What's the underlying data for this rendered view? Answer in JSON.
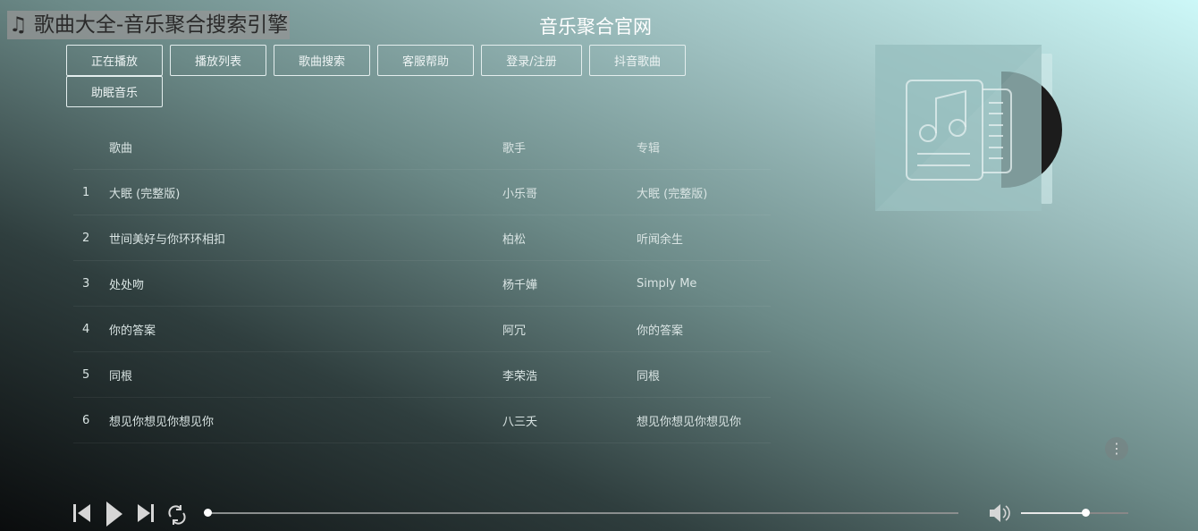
{
  "header": {
    "site_title": "♫ 歌曲大全-音乐聚合搜索引擎",
    "brand": "音乐聚合官网"
  },
  "nav": [
    "正在播放",
    "播放列表",
    "歌曲搜索",
    "客服帮助",
    "登录/注册",
    "抖音歌曲",
    "助眠音乐"
  ],
  "table": {
    "columns": {
      "song": "歌曲",
      "singer": "歌手",
      "album": "专辑"
    },
    "rows": [
      {
        "idx": "1",
        "song": "大眠 (完整版)",
        "singer": "小乐哥",
        "album": "大眠 (完整版)"
      },
      {
        "idx": "2",
        "song": "世间美好与你环环相扣",
        "singer": "柏松",
        "album": "听闻余生"
      },
      {
        "idx": "3",
        "song": "处处吻",
        "singer": "杨千嬅",
        "album": "Simply Me"
      },
      {
        "idx": "4",
        "song": "你的答案",
        "singer": "阿冗",
        "album": "你的答案"
      },
      {
        "idx": "5",
        "song": "同根",
        "singer": "李荣浩",
        "album": "同根"
      },
      {
        "idx": "6",
        "song": "想见你想见你想见你",
        "singer": "八三夭",
        "album": "想见你想见你想见你"
      }
    ]
  },
  "player": {
    "progress_percent": 0,
    "volume_percent": 60,
    "more_icon": "⋮"
  }
}
